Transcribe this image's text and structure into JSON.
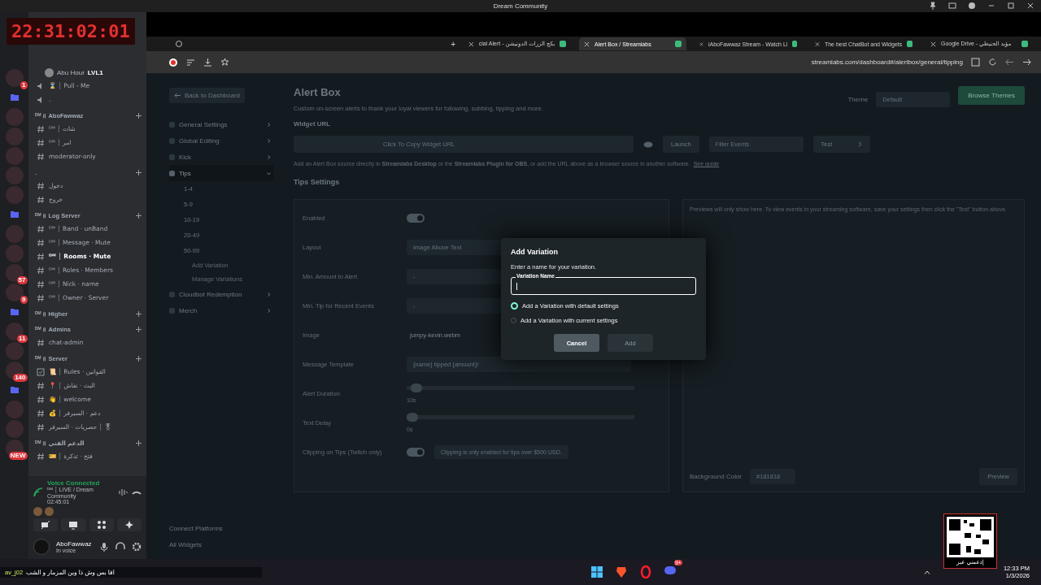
{
  "window": {
    "title": "Dream Community"
  },
  "stream_overlay": {
    "timer": "22:31:02:01"
  },
  "discord": {
    "servers": [
      {
        "kind": "server",
        "badge": "1"
      },
      {
        "kind": "folder"
      },
      {
        "kind": "server"
      },
      {
        "kind": "server"
      },
      {
        "kind": "server"
      },
      {
        "kind": "server"
      },
      {
        "kind": "server"
      },
      {
        "kind": "folder"
      },
      {
        "kind": "server"
      },
      {
        "kind": "server"
      },
      {
        "kind": "server",
        "badge": "57"
      },
      {
        "kind": "server",
        "badge": "9"
      },
      {
        "kind": "folder"
      },
      {
        "kind": "server",
        "badge": "11"
      },
      {
        "kind": "server"
      },
      {
        "kind": "server",
        "badge": "140"
      },
      {
        "kind": "folder"
      },
      {
        "kind": "server"
      },
      {
        "kind": "server"
      },
      {
        "kind": "server",
        "badge": "NEW"
      }
    ],
    "voice_user": {
      "name": "Abu Hour",
      "badge": "LVL1"
    },
    "channels": [
      {
        "kind": "voice",
        "name": "⌛ ┆ Pull - Me",
        "selected": false
      },
      {
        "kind": "voice",
        "name": ".",
        "selected": false
      },
      {
        "kind": "category",
        "name": "ᴰᴹ ॥ AboFawwaz"
      },
      {
        "kind": "text",
        "name": "ᴰᴹ ┆ شات",
        "selected": false
      },
      {
        "kind": "text",
        "name": "ᴰᴹ ┆ امر",
        "selected": false
      },
      {
        "kind": "text",
        "name": "moderator-only",
        "selected": false
      },
      {
        "kind": "category",
        "name": "."
      },
      {
        "kind": "text",
        "name": "دخول",
        "selected": false
      },
      {
        "kind": "text",
        "name": "خروج",
        "selected": false
      },
      {
        "kind": "category",
        "name": "ᴰᴹ ॥ Log Server"
      },
      {
        "kind": "text",
        "name": "ᴰᴹ ┆ Band · unBand",
        "selected": false
      },
      {
        "kind": "text",
        "name": "ᴰᴹ ┆ Message · Mute",
        "selected": false
      },
      {
        "kind": "text",
        "name": "ᴰᴹ ┆ Rooms · Mute",
        "selected": true
      },
      {
        "kind": "text",
        "name": "ᴰᴹ ┆ Roles · Members",
        "selected": false
      },
      {
        "kind": "text",
        "name": "ᴰᴹ ┆ Nick · name",
        "selected": false
      },
      {
        "kind": "text",
        "name": "ᴰᴹ ┆ Owner · Server",
        "selected": false
      },
      {
        "kind": "category",
        "name": "ᴰᴹ ॥ Higher"
      },
      {
        "kind": "category",
        "name": "ᴰᴹ ॥ Admins"
      },
      {
        "kind": "text",
        "name": "chat-admin",
        "selected": false
      },
      {
        "kind": "category",
        "name": "ᴰᴹ ॥ Server"
      },
      {
        "kind": "rules",
        "name": "📜 ┆ Rules · القوانين",
        "selected": false
      },
      {
        "kind": "text",
        "name": "📍 ┆ البث · نقاش",
        "selected": false
      },
      {
        "kind": "text",
        "name": "👋 ┆ welcome",
        "selected": false
      },
      {
        "kind": "text",
        "name": "💰 ┆ دعم · السيرفر",
        "selected": false
      },
      {
        "kind": "text",
        "name": "حصريات · السيرفر ┆ 🎖",
        "selected": false
      },
      {
        "kind": "category",
        "name": "ᴰᴹ ॥ الدعم الفني"
      },
      {
        "kind": "text",
        "name": "🎫 ┆ فتح · تذكرة",
        "selected": false
      }
    ],
    "voice_panel": {
      "status": "Voice Connected",
      "channel": "ᴰᴹ ┆ LIVE / Dream Community",
      "elapsed": "02:45:01"
    },
    "user": {
      "name": "AboFawwaz",
      "status": "In voice"
    }
  },
  "browser": {
    "tabs": [
      {
        "title": "cial Alert - بكج الزرات الدونيشن",
        "selected": false
      },
      {
        "title": "Alert Box / Streamlabs",
        "selected": true
      },
      {
        "title": "iAboFawwaz Stream - Watch Li",
        "selected": false
      },
      {
        "title": "The best ChatBot and Widgets",
        "selected": false
      },
      {
        "title": "Google Drive - مؤيد الحنيطي",
        "selected": false
      }
    ],
    "new_tab": "+",
    "url": "streamlabs.com/dashboard#/alertbox/general/tipping"
  },
  "page": {
    "back": "Back to Dashboard",
    "nav": [
      {
        "label": "General Settings",
        "selected": false,
        "expanded": false
      },
      {
        "label": "Global Editing",
        "selected": false,
        "expanded": false
      },
      {
        "label": "Kick",
        "selected": false,
        "expanded": false
      },
      {
        "label": "Tips",
        "selected": true,
        "expanded": true,
        "children": [
          "1-4",
          "5-9",
          "10-19",
          "20-49",
          "50-99"
        ],
        "actions": [
          "Add Variation",
          "Manage Variations"
        ]
      },
      {
        "label": "Cloudbot Redemption",
        "selected": false,
        "expanded": false
      },
      {
        "label": "Merch",
        "selected": false,
        "expanded": false
      }
    ],
    "nav_footer": [
      "Connect Platforms",
      "All Widgets"
    ],
    "title": "Alert Box",
    "description": "Custom on-screen alerts to thank your loyal viewers for following, subbing, tipping and more.",
    "theme_label": "Theme",
    "theme_value": "Default",
    "browse_themes": "Browse Themes",
    "widget_url_label": "Widget URL",
    "copy_url": "Click To Copy Widget URL",
    "launch": "Launch",
    "filter_events": "Filter Events",
    "test": "Test",
    "info": "Add an Alert Box source directly in **Streamlabs Desktop** or the **Streamlabs Plugin for OBS**, or add the URL above as a browser source in another software.",
    "see_guide": "See guide",
    "section_title": "Tips Settings",
    "settings": [
      {
        "kind": "toggle",
        "label": "Enabled",
        "on": true
      },
      {
        "kind": "select",
        "label": "Layout",
        "value": "Image Above Text"
      },
      {
        "kind": "input",
        "label": "Min. Amount to Alert",
        "value": "-"
      },
      {
        "kind": "input",
        "label": "Min. Tip for Recent Events",
        "value": "-"
      },
      {
        "kind": "file",
        "label": "Image",
        "value": "jumpy-kevin.webm"
      },
      {
        "kind": "input",
        "label": "Message Template",
        "value": "{name} tipped {amount}!"
      },
      {
        "kind": "slider",
        "label": "Alert Duration",
        "level": 0.02,
        "reading": "10s"
      },
      {
        "kind": "slider",
        "label": "Text Delay",
        "level": 0,
        "reading": "0s"
      },
      {
        "kind": "toggle",
        "label": "Clipping on Tips (Twitch only)",
        "on": true,
        "note": "Clipping is only enabled for tips over $500 USD."
      }
    ],
    "preview_notice": "Previews will only show here. To view events in your streaming software, save your settings then click the \"Test\" button above.",
    "background_color_label": "Background Color",
    "background_color_value": "#181818",
    "preview": "Preview"
  },
  "dialog": {
    "title": "Add Variation",
    "prompt": "Enter a name for your variation.",
    "field_label": "Variation Name",
    "options": [
      {
        "label": "Add a Variation with default settings",
        "selected": true
      },
      {
        "label": "Add a Variation with current settings",
        "selected": false
      }
    ],
    "cancel": "Cancel",
    "add": "Add",
    "add_disabled": true
  },
  "taskbar": {
    "chat_user": "av_j02",
    "chat_message": "افا بس وش ذا وين المزمار و الشب",
    "discord_badge": "9+",
    "time": "12:33 PM",
    "date": "1/3/2026",
    "qr_caption": "إدعمني عبر"
  }
}
